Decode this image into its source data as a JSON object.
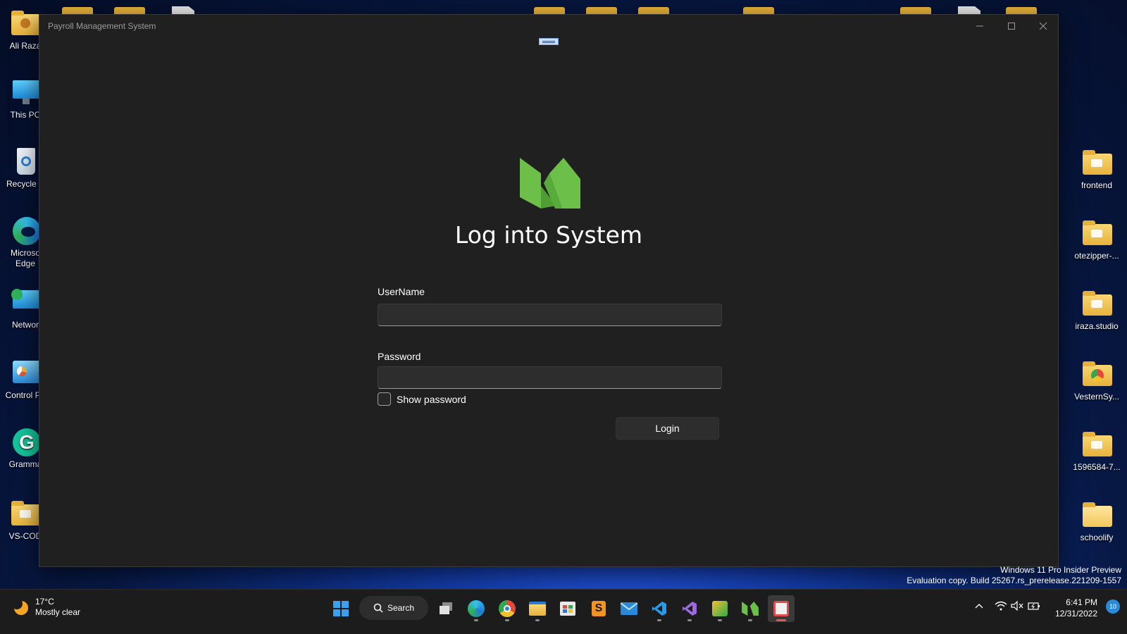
{
  "desktop": {
    "left_icons": [
      {
        "label": "Ali Raza",
        "icon": "user-folder-icon"
      },
      {
        "label": "This PC",
        "icon": "computer-icon"
      },
      {
        "label": "Recycle B",
        "icon": "recycle-bin-icon"
      },
      {
        "label": "Microso",
        "label2": "Edge",
        "icon": "edge-icon"
      },
      {
        "label": "Networ",
        "icon": "network-icon"
      },
      {
        "label": "Control Pa",
        "icon": "control-panel-icon"
      },
      {
        "label": "Gramma",
        "icon": "grammarly-icon"
      },
      {
        "label": "VS-COD",
        "icon": "folder-icon"
      }
    ],
    "right_icons": [
      {
        "label": "frontend",
        "icon": "folder-icon"
      },
      {
        "label": "otezipper-...",
        "icon": "folder-icon"
      },
      {
        "label": "iraza.studio",
        "icon": "folder-icon"
      },
      {
        "label": "VesternSy...",
        "icon": "folder-icon"
      },
      {
        "label": "1596584-7...",
        "icon": "folder-icon"
      },
      {
        "label": "schoolify",
        "icon": "folder-icon"
      }
    ]
  },
  "window": {
    "title": "Payroll Management System",
    "heading": "Log into System",
    "username_label": "UserName",
    "username_value": "",
    "password_label": "Password",
    "password_value": "",
    "show_password_label": "Show password",
    "show_password_checked": false,
    "login_label": "Login",
    "logo_color": "#6cbf48"
  },
  "watermark": {
    "line1": "Windows 11 Pro Insider Preview",
    "line2": "Evaluation copy. Build 25267.rs_prerelease.221209-1557"
  },
  "taskbar": {
    "weather_temp": "17°C",
    "weather_desc": "Mostly clear",
    "search_label": "Search",
    "apps": [
      "start-icon",
      "search",
      "task-view-icon",
      "edge-icon",
      "chrome-icon",
      "file-explorer-icon",
      "store-icon",
      "sublime-icon",
      "mail-icon",
      "vscode-icon",
      "visual-studio-icon",
      "snip-icon",
      "app-logo-icon",
      "payroll-app-icon"
    ],
    "time": "6:41 PM",
    "date": "12/31/2022",
    "notification_count": "10"
  }
}
